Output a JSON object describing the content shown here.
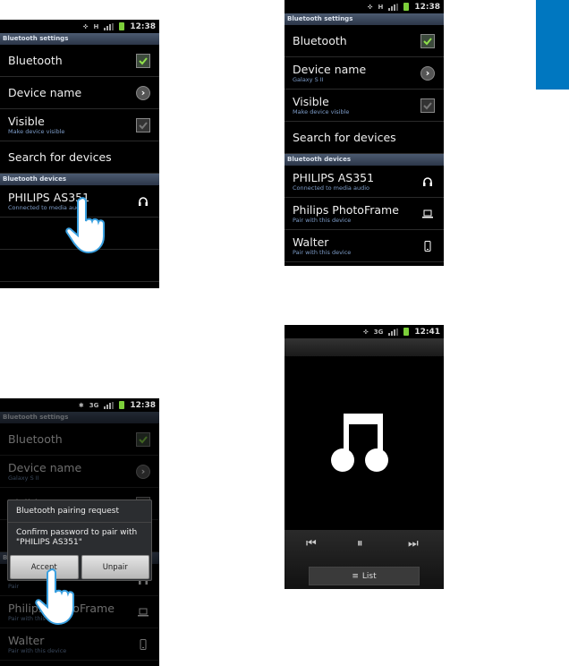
{
  "section_tab_color": "#0077c0",
  "phones": [
    {
      "id": "p1",
      "status_time": "12:38",
      "network": "H",
      "sections": [
        {
          "header": "Bluetooth settings",
          "rows": [
            {
              "title": "Bluetooth",
              "control": "checkbox-checked"
            },
            {
              "title": "Device name",
              "control": "arrow"
            },
            {
              "title": "Visible",
              "subtitle": "Make device visible",
              "control": "checkbox-disabled"
            },
            {
              "title": "Search for devices"
            }
          ]
        },
        {
          "header": "Bluetooth devices",
          "rows": [
            {
              "title": "PHILIPS AS351",
              "subtitle": "Connected to media audio",
              "control": "headphones"
            },
            {
              "title": ""
            },
            {
              "title": ""
            }
          ]
        }
      ]
    },
    {
      "id": "p2",
      "status_time": "12:38",
      "network": "H",
      "sections": [
        {
          "header": "Bluetooth settings",
          "rows": [
            {
              "title": "Bluetooth",
              "control": "checkbox-checked"
            },
            {
              "title": "Device name",
              "subtitle": "Galaxy S II",
              "control": "arrow"
            },
            {
              "title": "Visible",
              "subtitle": "Make device visible",
              "control": "checkbox-disabled"
            },
            {
              "title": "Search for devices"
            }
          ]
        },
        {
          "header": "Bluetooth devices",
          "rows": [
            {
              "title": "PHILIPS AS351",
              "subtitle": "Connected to media audio",
              "control": "headphones"
            },
            {
              "title": "Philips PhotoFrame",
              "subtitle": "Pair with this device",
              "control": "laptop"
            },
            {
              "title": "Walter",
              "subtitle": "Pair with this device",
              "control": "phone"
            }
          ]
        }
      ]
    },
    {
      "id": "p3",
      "status_time": "12:38",
      "network": "3G",
      "sections": [
        {
          "header": "Bluetooth settings",
          "rows": [
            {
              "title": "Bluetooth",
              "control": "checkbox-checked"
            },
            {
              "title": "Device name",
              "subtitle": "Galaxy S II",
              "control": "arrow"
            },
            {
              "title": "Visible",
              "control": "checkbox-disabled"
            },
            {
              "title": "Search for devices"
            }
          ]
        },
        {
          "header": "Bluetooth devices",
          "rows": [
            {
              "title": "PHILIPS AS351",
              "subtitle": "Pair",
              "control": "headphones"
            },
            {
              "title": "Philips PhotoFrame",
              "subtitle": "Pair with this device",
              "control": "laptop"
            },
            {
              "title": "Walter",
              "subtitle": "Pair with this device",
              "control": "phone"
            }
          ]
        }
      ],
      "dialog": {
        "title": "Bluetooth pairing request",
        "message": "Confirm password to pair with \"PHILIPS AS351\"",
        "accept": "Accept",
        "unpair": "Unpair"
      }
    }
  ],
  "player": {
    "status_time": "12:41",
    "network": "3G",
    "list_label": "List",
    "list_icon": "≡"
  }
}
